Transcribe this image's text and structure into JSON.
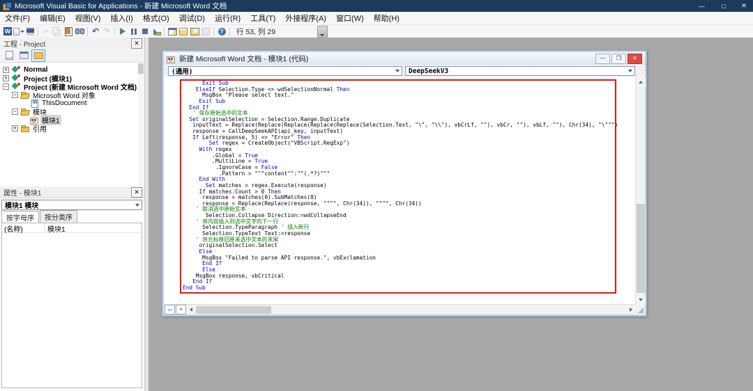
{
  "window": {
    "title": "Microsoft Visual Basic for Applications - 新建 Microsoft Word 文档",
    "controls": [
      {
        "name": "minimize-button",
        "glyph": "—"
      },
      {
        "name": "maximize-button",
        "glyph": "□"
      },
      {
        "name": "close-button",
        "glyph": "✕"
      }
    ]
  },
  "menu": {
    "items": [
      {
        "label": "文件(F)",
        "name": "menu-file"
      },
      {
        "label": "编辑(E)",
        "name": "menu-edit"
      },
      {
        "label": "视图(V)",
        "name": "menu-view"
      },
      {
        "label": "插入(I)",
        "name": "menu-insert"
      },
      {
        "label": "格式(O)",
        "name": "menu-format"
      },
      {
        "label": "调试(D)",
        "name": "menu-debug"
      },
      {
        "label": "运行(R)",
        "name": "menu-run"
      },
      {
        "label": "工具(T)",
        "name": "menu-tools"
      },
      {
        "label": "外接程序(A)",
        "name": "menu-addins"
      },
      {
        "label": "窗口(W)",
        "name": "menu-window"
      },
      {
        "label": "帮助(H)",
        "name": "menu-help"
      }
    ]
  },
  "toolbar": {
    "status": "行 53, 列 29",
    "icons": [
      {
        "name": "word-icon",
        "kind": "word"
      },
      {
        "name": "insert-userform-icon",
        "kind": "form"
      },
      {
        "name": "save-icon",
        "kind": "save"
      },
      {
        "sep": true
      },
      {
        "name": "cut-icon",
        "kind": "cut",
        "disabled": true
      },
      {
        "name": "copy-icon",
        "kind": "copy",
        "disabled": true
      },
      {
        "name": "paste-icon",
        "kind": "paste"
      },
      {
        "name": "find-icon",
        "kind": "find"
      },
      {
        "sep": true
      },
      {
        "name": "undo-icon",
        "kind": "undo"
      },
      {
        "name": "redo-icon",
        "kind": "redo",
        "disabled": true
      },
      {
        "sep": true
      },
      {
        "name": "run-icon",
        "kind": "run"
      },
      {
        "name": "break-icon",
        "kind": "break"
      },
      {
        "name": "reset-icon",
        "kind": "reset"
      },
      {
        "name": "design-mode-icon",
        "kind": "design"
      },
      {
        "sep": true
      },
      {
        "name": "project-explorer-icon",
        "kind": "projexp"
      },
      {
        "name": "properties-window-icon",
        "kind": "props"
      },
      {
        "name": "object-browser-icon",
        "kind": "objbrow"
      },
      {
        "name": "toolbox-icon",
        "kind": "toolbox",
        "disabled": true
      },
      {
        "sep": true
      },
      {
        "name": "help-icon",
        "kind": "help"
      },
      {
        "sep": true
      }
    ]
  },
  "project_panel": {
    "title": "工程 - Project",
    "tools": [
      {
        "name": "view-code-icon",
        "kind": "pt-code"
      },
      {
        "name": "view-object-icon",
        "kind": "pt-object"
      },
      {
        "name": "toggle-folders-icon",
        "kind": "pt-folders",
        "active": true
      }
    ],
    "tree": [
      {
        "e": "+",
        "i": "project",
        "l": "Normal",
        "b": true,
        "d": 0,
        "name": "tree-item-normal"
      },
      {
        "e": "+",
        "i": "project",
        "l": "Project (模块1)",
        "b": true,
        "d": 0,
        "name": "tree-item-project-module1"
      },
      {
        "e": "-",
        "i": "project",
        "l": "Project (新建 Microsoft Word 文档)",
        "b": true,
        "d": 0,
        "name": "tree-item-project-new-word-doc"
      },
      {
        "e": "-",
        "i": "folder-open",
        "l": "Microsoft Word 对象",
        "d": 1,
        "name": "tree-item-word-objects"
      },
      {
        "e": "",
        "i": "doc",
        "l": "ThisDocument",
        "d": 2,
        "name": "tree-item-thisdocument"
      },
      {
        "e": "-",
        "i": "folder-open",
        "l": "模块",
        "d": 1,
        "name": "tree-item-modules-folder"
      },
      {
        "e": "",
        "i": "module",
        "l": "模块1",
        "d": 2,
        "s": true,
        "name": "tree-item-module1"
      },
      {
        "e": "+",
        "i": "folder",
        "l": "引用",
        "d": 1,
        "name": "tree-item-references"
      }
    ]
  },
  "properties_panel": {
    "title": "属性 - 模块1",
    "selector": "模块1 模块",
    "tabs": [
      "按字母序",
      "按分类序"
    ],
    "rows": [
      {
        "name": "(名称)",
        "value": "模块1"
      }
    ]
  },
  "code_window": {
    "title": "新建 Microsoft Word 文档 - 模块1 (代码)",
    "left_dropdown": "(通用)",
    "right_dropdown": "DeepSeekV3",
    "controls": [
      {
        "name": "code-minimize-button",
        "glyph": "—"
      },
      {
        "name": "code-restore-button",
        "glyph": "❐"
      },
      {
        "name": "code-close-button",
        "glyph": "✕",
        "close": true
      }
    ],
    "code_lines": [
      [
        [
          "      ",
          "t"
        ],
        [
          "Exit Sub",
          "k"
        ]
      ],
      [
        [
          "    ",
          "t"
        ],
        [
          "ElseIf",
          "k"
        ],
        [
          " Selection.Type <> wdSelectionNormal ",
          "t"
        ],
        [
          "Then",
          "k"
        ]
      ],
      [
        [
          "      MsgBox \"Please select text.\"",
          "t"
        ]
      ],
      [
        [
          "     ",
          "t"
        ],
        [
          "Exit Sub",
          "k"
        ]
      ],
      [
        [
          "  ",
          "t"
        ],
        [
          "End If",
          "k"
        ]
      ],
      [
        [
          "   ' 保存原始选中的文本",
          "c"
        ]
      ],
      [
        [
          "  ",
          "t"
        ],
        [
          "Set",
          "k"
        ],
        [
          " originalSelection = Selection.Range.Duplicate",
          "t"
        ]
      ],
      [
        [
          "   inputText = Replace(Replace(Replace(Replace(Replace(Selection.Text, \"\\\", \"\\\\\"), vbCrLf, \"\"), vbCr, \"\"), vbLf, \"\"), Chr(34), \"\\\"\"\")",
          "t"
        ]
      ],
      [
        [
          "   response = CallDeepSeekAPI(api_key, inputText)",
          "t"
        ]
      ],
      [
        [
          "   ",
          "t"
        ],
        [
          "If",
          "k"
        ],
        [
          " Left(response, 5) <> \"Error\" ",
          "t"
        ],
        [
          "Then",
          "k"
        ]
      ],
      [
        [
          "        ",
          "t"
        ],
        [
          "Set",
          "k"
        ],
        [
          " regex = CreateObject(\"VBScript.RegExp\")",
          "t"
        ]
      ],
      [
        [
          "     ",
          "t"
        ],
        [
          "With",
          "k"
        ],
        [
          " regex",
          "t"
        ]
      ],
      [
        [
          "         .Global = ",
          "t"
        ],
        [
          "True",
          "k"
        ]
      ],
      [
        [
          "         .MultiLine = ",
          "t"
        ],
        [
          "True",
          "k"
        ]
      ],
      [
        [
          "          .IgnoreCase = ",
          "t"
        ],
        [
          "False",
          "k"
        ]
      ],
      [
        [
          "           .Pattern = \"\"\"content\"\":\"\"(.*?)\"\"\"",
          "t"
        ]
      ],
      [
        [
          "     ",
          "t"
        ],
        [
          "End With",
          "k"
        ]
      ],
      [
        [
          "       ",
          "t"
        ],
        [
          "Set",
          "k"
        ],
        [
          " matches = regex.Execute(response)",
          "t"
        ]
      ],
      [
        [
          "     ",
          "t"
        ],
        [
          "If",
          "k"
        ],
        [
          " matches.Count > 0 ",
          "t"
        ],
        [
          "Then",
          "k"
        ]
      ],
      [
        [
          "      response = matches(0).SubMatches(0)",
          "t"
        ]
      ],
      [
        [
          "      response = Replace(Replace(response, \"\"\"\", Chr(34)), \"\"\"\", Chr(34))",
          "t"
        ]
      ],
      [
        [
          "    ' 取消选中原始文本",
          "c"
        ]
      ],
      [
        [
          "       Selection.Collapse Direction:=wdCollapseEnd",
          "t"
        ]
      ],
      [
        [
          "    ' 将内容插入到选中文字的下一行",
          "c"
        ]
      ],
      [
        [
          "      Selection.TypeParagraph ",
          "t"
        ],
        [
          "' 插入新行",
          "c"
        ]
      ],
      [
        [
          "      Selection.TypeText Text:=response",
          "t"
        ]
      ],
      [
        [
          "    ' 将光标移回原来选中文本的末尾",
          "c"
        ]
      ],
      [
        [
          "     originalSelection.Select",
          "t"
        ]
      ],
      [
        [
          "     ",
          "t"
        ],
        [
          "Else",
          "k"
        ]
      ],
      [
        [
          "      MsgBox \"Failed to parse API response.\", vbExclamation",
          "t"
        ]
      ],
      [
        [
          "      ",
          "t"
        ],
        [
          "End If",
          "k"
        ]
      ],
      [
        [
          "      ",
          "t"
        ],
        [
          "Else",
          "k"
        ]
      ],
      [
        [
          "    MsgBox response, vbCritical",
          "t"
        ]
      ],
      [
        [
          "   ",
          "t"
        ],
        [
          "End If",
          "k"
        ]
      ],
      [
        [
          "",
          "t"
        ],
        [
          "End Sub",
          "k"
        ]
      ]
    ]
  },
  "colors": {
    "titlebar": "#1c3a5e",
    "mdi": "#a8a8a8",
    "keyword": "#0000cc",
    "comment": "#007f00",
    "annotation": "#ee1111",
    "close_button": "#e14b41"
  }
}
